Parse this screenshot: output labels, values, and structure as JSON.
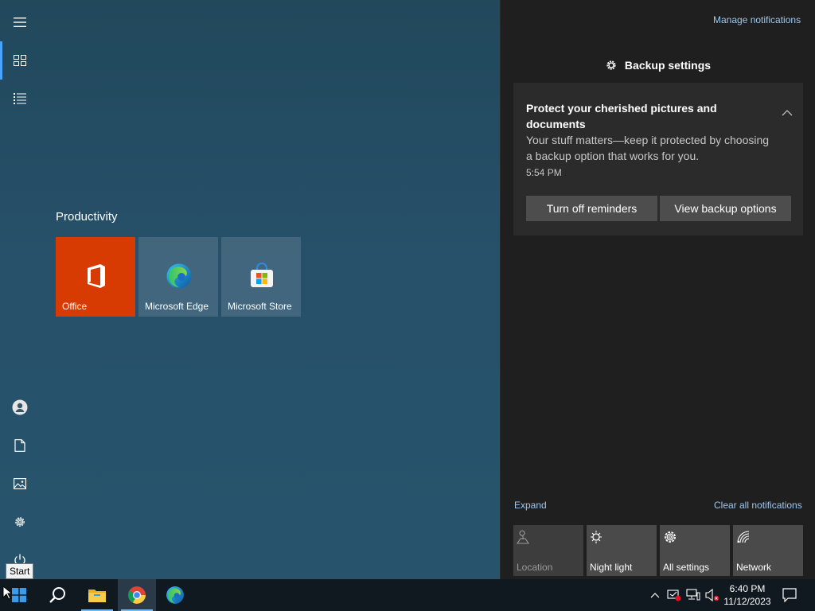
{
  "start_menu": {
    "tooltip": "Start",
    "group_title": "Productivity",
    "tiles": [
      {
        "label": "Office",
        "color": "#d83b01"
      },
      {
        "label": "Microsoft Edge"
      },
      {
        "label": "Microsoft Store"
      }
    ]
  },
  "action_center": {
    "manage_link": "Manage notifications",
    "app_header": "Backup settings",
    "notification": {
      "title": "Protect your cherished pictures and documents",
      "body": "Your stuff matters—keep it protected by choosing a backup option that works for you.",
      "time": "5:54 PM",
      "buttons": [
        "Turn off reminders",
        "View backup options"
      ]
    },
    "expand_link": "Expand",
    "clear_link": "Clear all notifications",
    "quick_actions": [
      {
        "label": "Location",
        "icon": "location-icon",
        "enabled": false
      },
      {
        "label": "Night light",
        "icon": "night-light-icon",
        "enabled": true
      },
      {
        "label": "All settings",
        "icon": "gear-icon",
        "enabled": true
      },
      {
        "label": "Network",
        "icon": "network-icon",
        "enabled": true
      }
    ]
  },
  "taskbar": {
    "clock_time": "6:40 PM",
    "clock_date": "11/12/2023"
  },
  "colors": {
    "accent": "#4aa3ff",
    "link": "#9fc7ee",
    "office": "#d83b01"
  }
}
